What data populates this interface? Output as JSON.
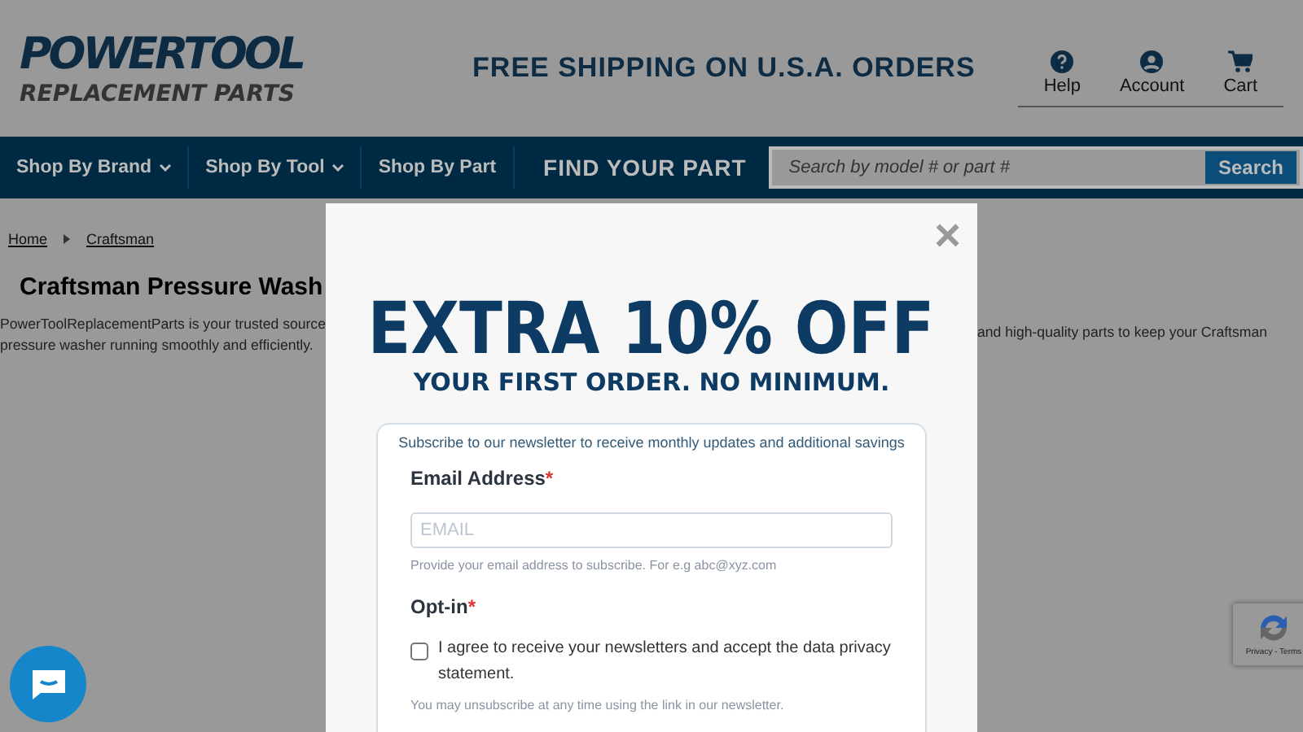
{
  "header": {
    "logo_top": "POWERTOOL",
    "logo_bottom": "REPLACEMENT PARTS",
    "promo": "FREE SHIPPING ON U.S.A. ORDERS",
    "links": [
      {
        "kind": "help",
        "label": "Help"
      },
      {
        "kind": "account",
        "label": "Account"
      },
      {
        "kind": "cart",
        "label": "Cart"
      }
    ]
  },
  "nav": {
    "items": [
      {
        "label": "Shop By Brand",
        "dropdown": true
      },
      {
        "label": "Shop By Tool",
        "dropdown": true
      },
      {
        "label": "Shop By Part",
        "dropdown": false
      }
    ],
    "find_label": "FIND YOUR PART",
    "search": {
      "placeholder": "Search by model # or part #",
      "button": "Search"
    }
  },
  "breadcrumb": [
    "Home",
    "Craftsman"
  ],
  "page": {
    "title": "Craftsman Pressure Wash",
    "intro_left": "PowerToolReplacementParts is your trusted source",
    "intro_right": "and high-quality parts to keep your Craftsman",
    "intro_line2": "pressure washer running smoothly and efficiently."
  },
  "modal": {
    "close": "×",
    "headline": "EXTRA 10% OFF",
    "subhead": "YOUR FIRST ORDER. NO MINIMUM.",
    "form": {
      "intro": "Subscribe to our newsletter to receive monthly updates and additional savings",
      "email_label": "Email Address",
      "email_required": "*",
      "email_placeholder": "EMAIL",
      "email_help": "Provide your email address to subscribe. For e.g abc@xyz.com",
      "optin_label": "Opt-in",
      "optin_required": "*",
      "optin_text": "I agree to receive your newsletters and accept the data privacy statement.",
      "optin_checked": false,
      "unsubscribe_note": "You may unsubscribe at any time using the link in our newsletter."
    }
  },
  "recaptcha": {
    "links": "Privacy - Terms"
  }
}
